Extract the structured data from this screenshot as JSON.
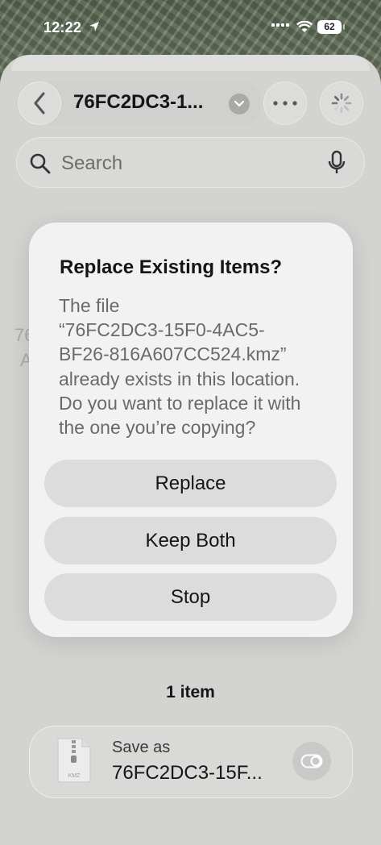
{
  "status": {
    "time": "12:22",
    "battery": "62"
  },
  "header": {
    "title": "76FC2DC3-1...",
    "back_icon": "chevron-left-icon",
    "more_icon": "ellipsis-icon",
    "loading_icon": "spinner-icon"
  },
  "search": {
    "placeholder": "Search"
  },
  "background": {
    "line1": "76",
    "line2": "A"
  },
  "dialog": {
    "title": "Replace Existing Items?",
    "message": "The file\n“76FC2DC3-15F0-4AC5-\nBF26-816A607CC524.kmz”\nalready exists in this location.\nDo you want to replace it with\nthe one you’re copying?",
    "buttons": {
      "replace": "Replace",
      "keep_both": "Keep Both",
      "stop": "Stop"
    }
  },
  "footer": {
    "item_count": "1 item",
    "save_label": "Save as",
    "save_name": "76FC2DC3-15F...",
    "file_icon_label": "KMZ"
  }
}
